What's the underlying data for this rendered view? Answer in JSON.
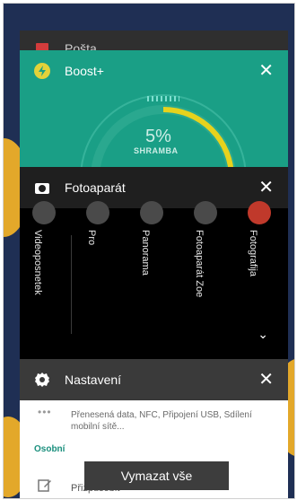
{
  "cards": {
    "posta": {
      "title": "Pošta"
    },
    "boost": {
      "title": "Boost+",
      "gauge_value": "5%",
      "gauge_label": "SHRAMBA",
      "close": "✕",
      "accent": "#1a9f86"
    },
    "foto": {
      "title": "Fotoaparát",
      "close": "✕",
      "modes": [
        "Videoposnetek",
        "Pro",
        "Panorama",
        "Fotoaparát Zoe",
        "Fotografija"
      ]
    },
    "nastaveni": {
      "title": "Nastavení",
      "close": "✕",
      "row_text": "Přenesená data, NFC, Připojení USB, Sdílení mobilní sítě...",
      "section": "Osobní",
      "item": "Přizpůsobit"
    }
  },
  "clear_all": "Vymazat vše"
}
